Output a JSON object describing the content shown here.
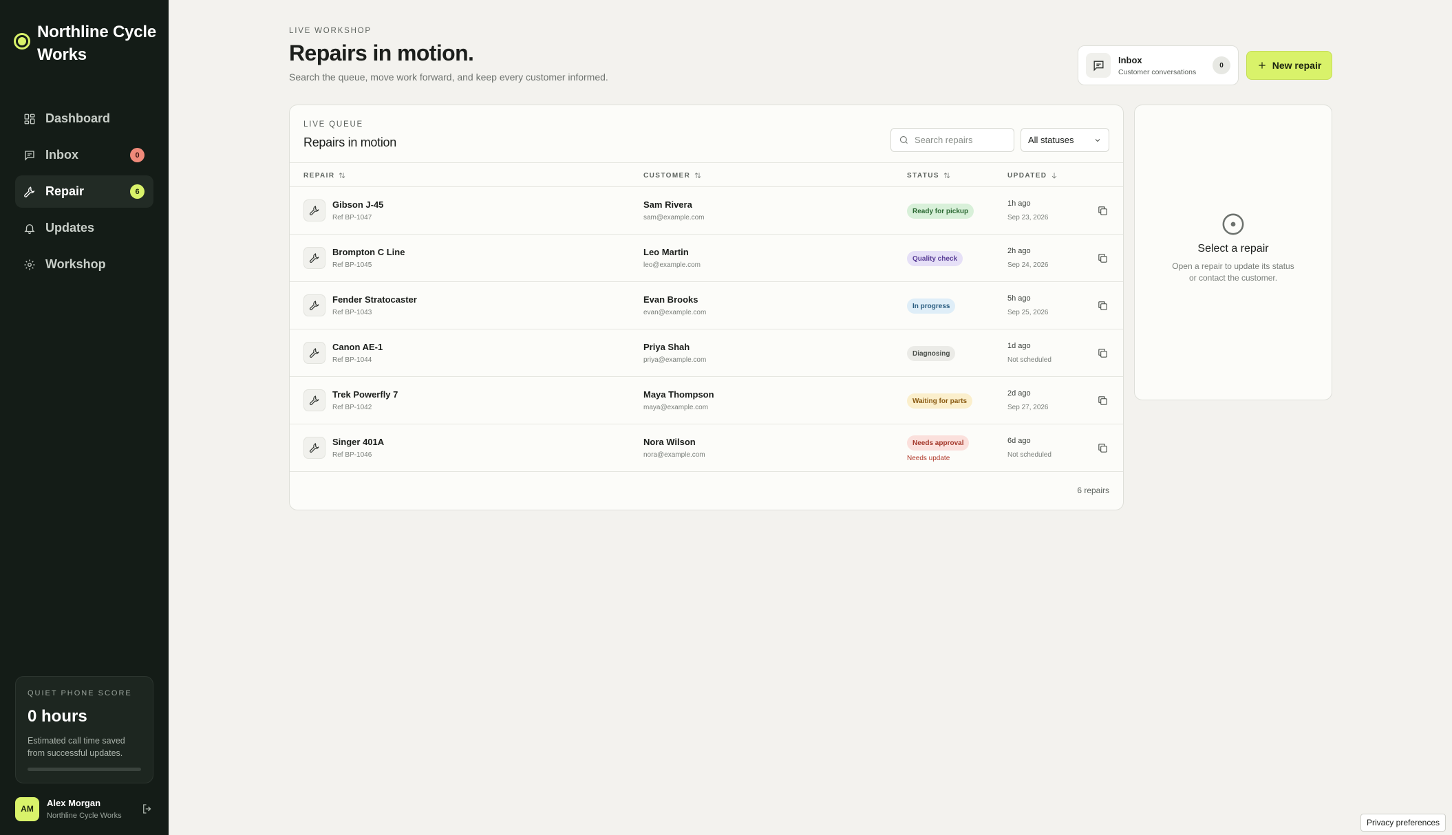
{
  "sidebar": {
    "brand": "Northline Cycle Works",
    "nav": [
      {
        "label": "Dashboard",
        "icon": "dashboard-icon"
      },
      {
        "label": "Inbox",
        "icon": "inbox-icon",
        "badge": "0",
        "badge_color": "#f08a7a"
      },
      {
        "label": "Repair",
        "icon": "wrench-icon",
        "badge": "6",
        "badge_color": "#d9f26a",
        "active": true
      },
      {
        "label": "Updates",
        "icon": "bell-icon"
      },
      {
        "label": "Workshop",
        "icon": "gear-icon"
      }
    ],
    "score": {
      "label": "QUIET PHONE SCORE",
      "value": "0 hours",
      "description": "Estimated call time saved from successful updates.",
      "progress": 0
    },
    "user": {
      "initials": "AM",
      "name": "Alex Morgan",
      "org": "Northline Cycle Works"
    }
  },
  "header": {
    "eyebrow": "LIVE WORKSHOP",
    "title": "Repairs in motion.",
    "subtitle": "Search the queue, move work forward, and keep every customer informed.",
    "inbox": {
      "title": "Inbox",
      "subtitle": "Customer conversations",
      "count": "0"
    },
    "new_button": "New repair"
  },
  "queue": {
    "eyebrow": "LIVE QUEUE",
    "title": "Repairs in motion",
    "search_placeholder": "Search repairs",
    "status_filter": "All statuses",
    "columns": {
      "repair": "REPAIR",
      "customer": "CUSTOMER",
      "status": "STATUS",
      "updated": "UPDATED"
    },
    "rows": [
      {
        "name": "Gibson J-45",
        "ref": "Ref BP-1047",
        "customer": "Sam Rivera",
        "email": "sam@example.com",
        "status": "Ready for pickup",
        "note": "",
        "ago": "1h ago",
        "date": "Sep 23, 2026"
      },
      {
        "name": "Brompton C Line",
        "ref": "Ref BP-1045",
        "customer": "Leo Martin",
        "email": "leo@example.com",
        "status": "Quality check",
        "note": "",
        "ago": "2h ago",
        "date": "Sep 24, 2026"
      },
      {
        "name": "Fender Stratocaster",
        "ref": "Ref BP-1043",
        "customer": "Evan Brooks",
        "email": "evan@example.com",
        "status": "In progress",
        "note": "",
        "ago": "5h ago",
        "date": "Sep 25, 2026"
      },
      {
        "name": "Canon AE-1",
        "ref": "Ref BP-1044",
        "customer": "Priya Shah",
        "email": "priya@example.com",
        "status": "Diagnosing",
        "note": "",
        "ago": "1d ago",
        "date": "Not scheduled"
      },
      {
        "name": "Trek Powerfly 7",
        "ref": "Ref BP-1042",
        "customer": "Maya Thompson",
        "email": "maya@example.com",
        "status": "Waiting for parts",
        "note": "",
        "ago": "2d ago",
        "date": "Sep 27, 2026"
      },
      {
        "name": "Singer 401A",
        "ref": "Ref BP-1046",
        "customer": "Nora Wilson",
        "email": "nora@example.com",
        "status": "Needs approval",
        "note": "Needs update",
        "ago": "6d ago",
        "date": "Not scheduled"
      }
    ],
    "status_colors": {
      "Ready for pickup": {
        "bg": "#d8f0d9",
        "fg": "#2c6a33"
      },
      "Quality check": {
        "bg": "#e6e0f7",
        "fg": "#5a3e97"
      },
      "In progress": {
        "bg": "#dfeef8",
        "fg": "#2a5d80"
      },
      "Diagnosing": {
        "bg": "#ebebe7",
        "fg": "#4a4f4a"
      },
      "Waiting for parts": {
        "bg": "#fbefcc",
        "fg": "#8a5b12"
      },
      "Needs approval": {
        "bg": "#fbe0dc",
        "fg": "#a3372a"
      }
    },
    "footer": "6 repairs"
  },
  "detail": {
    "title": "Select a repair",
    "text": "Open a repair to update its status or contact the customer."
  },
  "privacy": "Privacy preferences"
}
